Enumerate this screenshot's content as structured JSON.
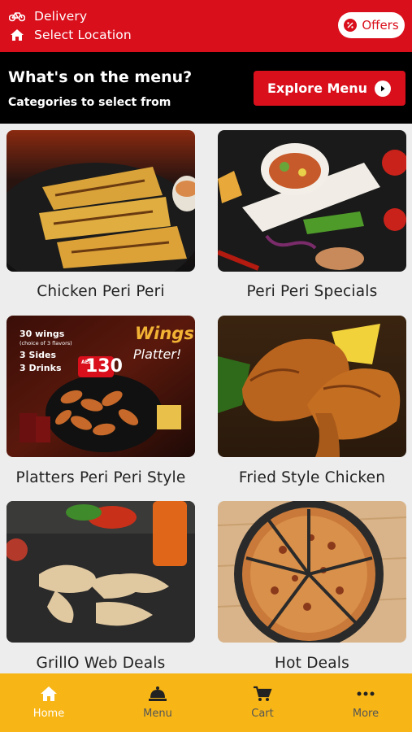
{
  "header": {
    "mode_label": "Delivery",
    "location_label": "Select Location",
    "offers_label": "Offers"
  },
  "banner": {
    "title": "What's on the menu?",
    "subtitle": "Categories to select from",
    "explore_label": "Explore Menu"
  },
  "categories": [
    {
      "label": "Chicken Peri Peri",
      "image": "grilled chicken on slate with dip"
    },
    {
      "label": "Peri Peri Specials",
      "image": "wrap with salad garnish"
    },
    {
      "label": "Platters Peri Peri Style",
      "image": "wings platter promo",
      "promo": {
        "line1": "30 wings",
        "line2": "(choice of 3 flavors)",
        "line3": "3 Sides",
        "line4": "3 Drinks",
        "price_prefix": "AED",
        "price": "130",
        "title1": "Wings",
        "title2": "Platter!"
      }
    },
    {
      "label": "Fried Style Chicken",
      "image": "fried chicken wings with lemon"
    },
    {
      "label": "GrillO Web Deals",
      "image": "raw chicken wings on slate"
    },
    {
      "label": "Hot Deals",
      "image": "pizza on tray"
    }
  ],
  "nav": {
    "items": [
      {
        "label": "Home",
        "icon": "home-icon",
        "active": true
      },
      {
        "label": "Menu",
        "icon": "cloche-icon",
        "active": false
      },
      {
        "label": "Cart",
        "icon": "cart-icon",
        "active": false
      },
      {
        "label": "More",
        "icon": "more-dots-icon",
        "active": false
      }
    ]
  },
  "colors": {
    "brand_red": "#d90f1c",
    "nav_yellow": "#f8b616",
    "banner_black": "#000000"
  }
}
